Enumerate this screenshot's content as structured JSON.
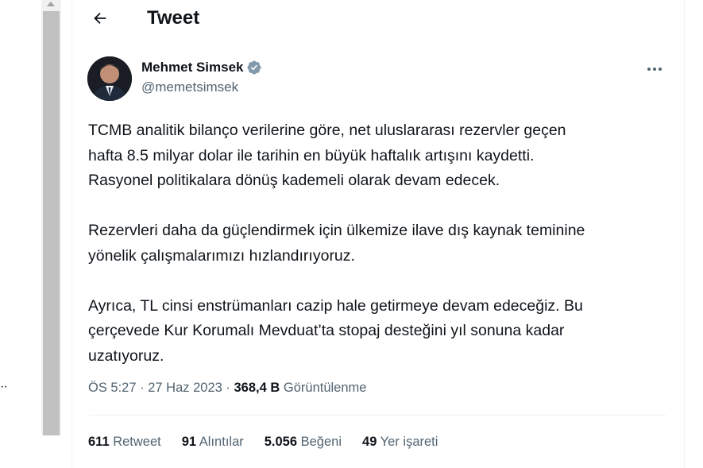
{
  "left_edge": {
    "text": "··"
  },
  "header": {
    "title": "Tweet",
    "back_icon": "arrow-left-icon"
  },
  "author": {
    "name": "Mehmet Simsek",
    "handle": "@memetsimsek",
    "verified_icon": "verified-badge-icon",
    "verified_color": "#829aab"
  },
  "more_icon": "more-horizontal-icon",
  "tweet": {
    "paragraph1_line1": "TCMB analitik bilanço verilerine göre, net uluslararası rezervler geçen",
    "paragraph1_line2": "hafta 8.5 milyar dolar ile tarihin en büyük haftalık artışını kaydetti.",
    "paragraph1_line3": "Rasyonel politikalara dönüş kademeli olarak devam edecek.",
    "paragraph2_line1": "Rezervleri daha da güçlendirmek için ülkemize ilave dış kaynak teminine",
    "paragraph2_line2": "yönelik çalışmalarımızı hızlandırıyoruz.",
    "paragraph3_line1": "Ayrıca, TL cinsi enstrümanları cazip hale getirmeye devam edeceğiz. Bu",
    "paragraph3_line2": "çerçevede Kur Korumalı Mevduat’ta stopaj desteğini yıl sonuna kadar",
    "paragraph3_line3": "uzatıyoruz."
  },
  "meta": {
    "time": "ÖS 5:27",
    "separator": "·",
    "date": "27 Haz 2023",
    "views_count": "368,4 B",
    "views_label": "Görüntülenme"
  },
  "stats": [
    {
      "count": "611",
      "label": "Retweet"
    },
    {
      "count": "91",
      "label": "Alıntılar"
    },
    {
      "count": "5.056",
      "label": "Beğeni"
    },
    {
      "count": "49",
      "label": "Yer işareti"
    }
  ]
}
